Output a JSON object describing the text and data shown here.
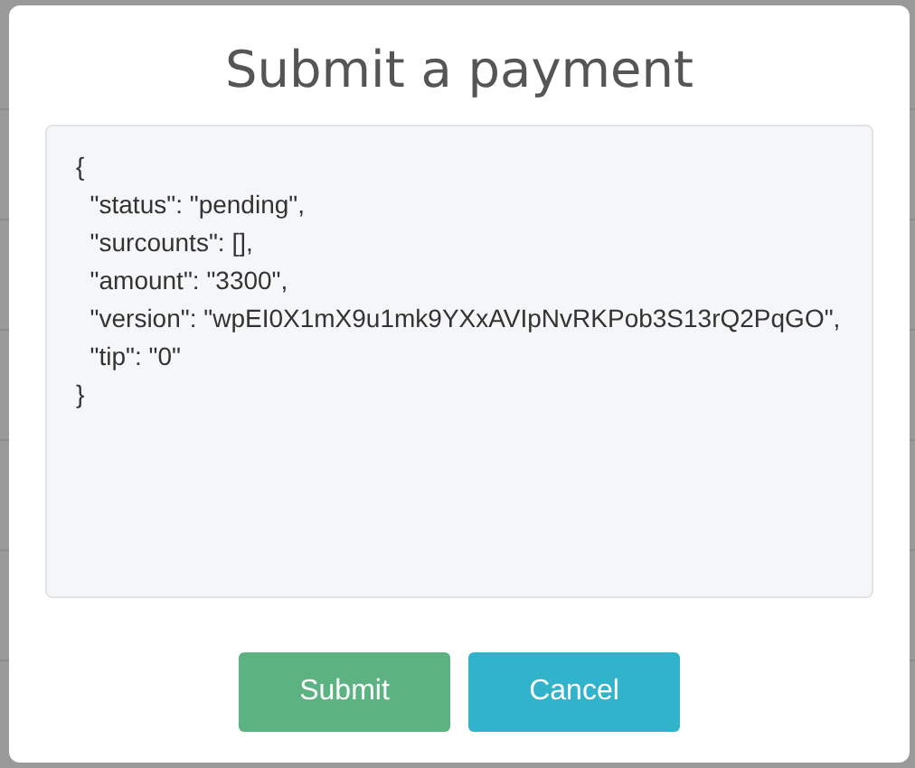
{
  "dialog": {
    "title": "Submit a payment",
    "code_lines": [
      "{",
      "  \"status\": \"pending\",",
      "  \"surcounts\": [],",
      "  \"amount\": \"3300\",",
      "  \"version\": \"wpEI0X1mX9u1mk9YXxAVIpNvRKPob3S13rQ2PqGO\",",
      "  \"tip\": \"0\"",
      "}"
    ],
    "buttons": [
      {
        "label": "Submit",
        "kind": "primary"
      },
      {
        "label": "Cancel",
        "kind": "secondary"
      }
    ]
  }
}
